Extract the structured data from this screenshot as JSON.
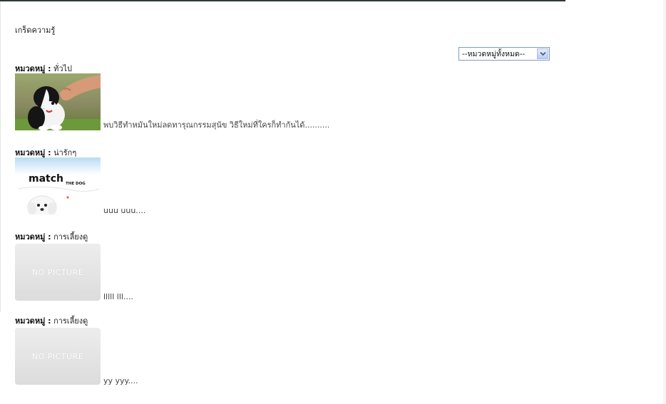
{
  "page": {
    "title": "เกร็ดความรู้"
  },
  "filter": {
    "selected": "--หมวดหมู่ทั้งหมด--"
  },
  "category_label": "หมวดหมู่ :",
  "items": [
    {
      "category": "ทั่วไป",
      "summary": "พบวิธีทำหมันใหม่ลดทารุณกรรมสุนัข วิธีใหม่ที่ใครก็ทำกันได้.........."
    },
    {
      "category": "น่ารักๆ",
      "thumb_title": "match",
      "thumb_subtitle": "THE DOG",
      "summary": "uuu uuu...."
    },
    {
      "category": "การเลี้ยงดู",
      "thumb_placeholder": "NO PICTURE",
      "summary": "lllll lll...."
    },
    {
      "category": "การเลี้ยงดู",
      "thumb_placeholder": "NO PICTURE",
      "summary": "yy yyy...."
    }
  ]
}
